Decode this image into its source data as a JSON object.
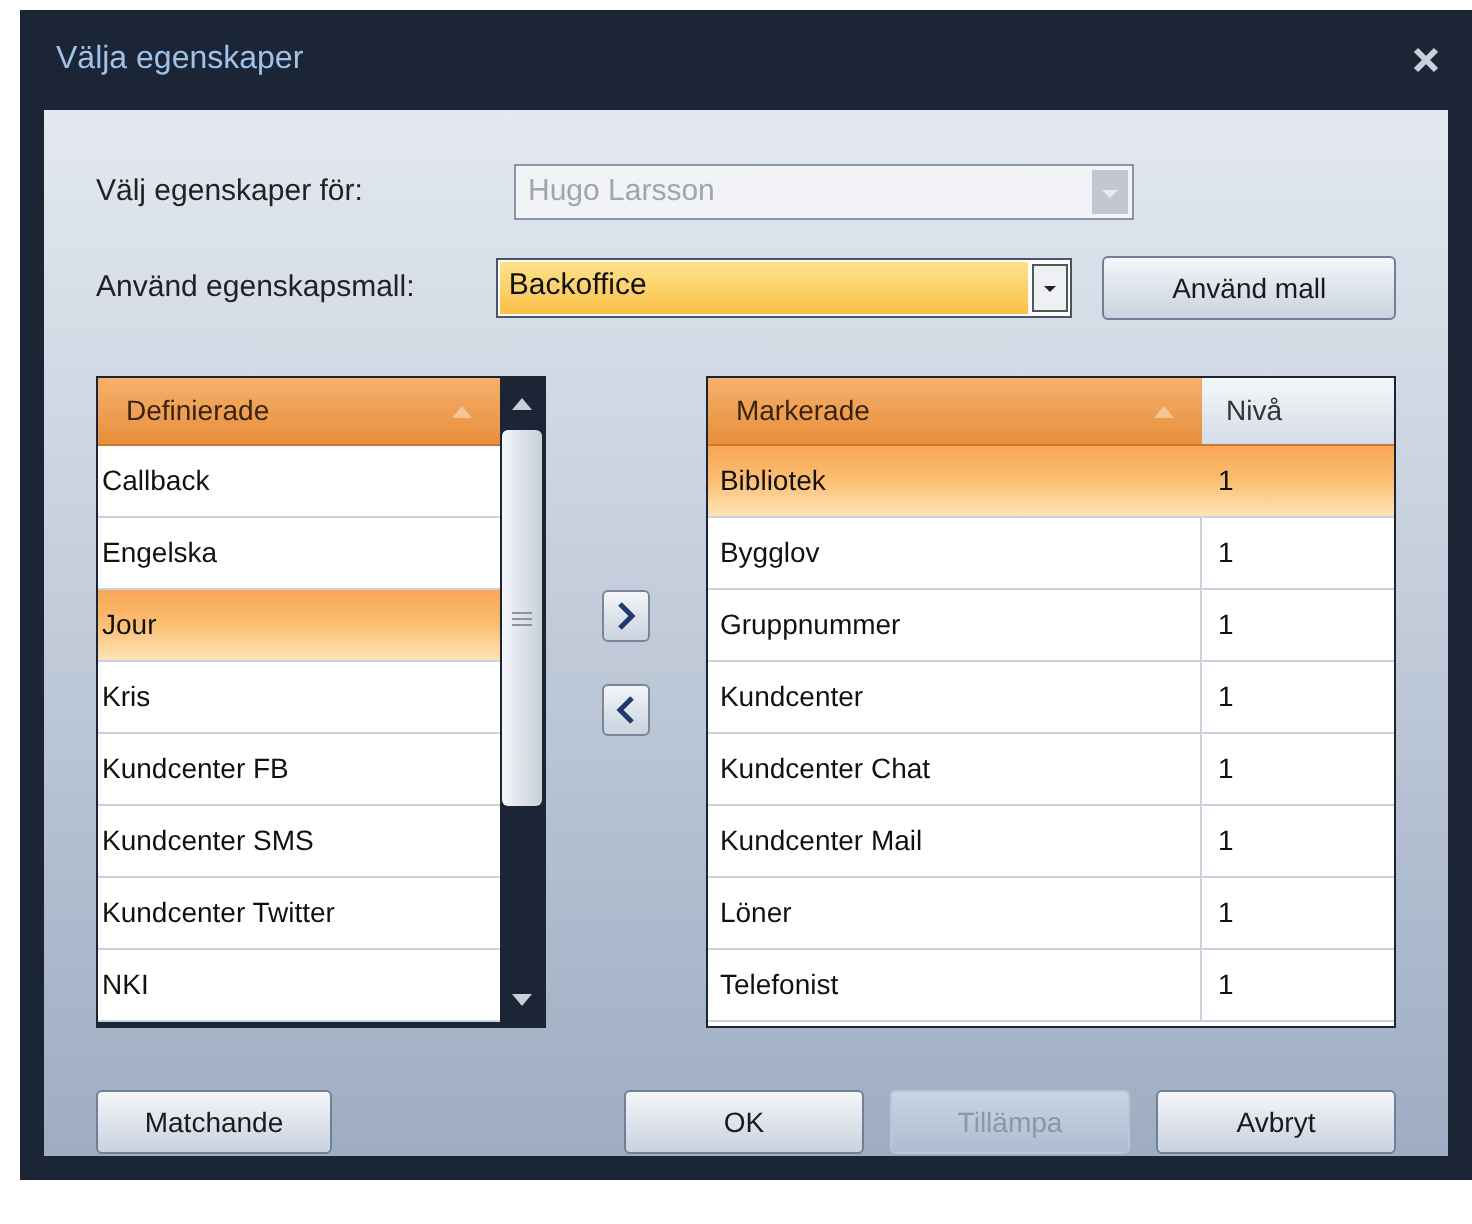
{
  "window": {
    "title": "Välja egenskaper"
  },
  "owner": {
    "label": "Välj egenskaper för:",
    "value": "Hugo Larsson",
    "disabled": true
  },
  "template": {
    "label": "Använd egenskapsmall:",
    "value": "Backoffice",
    "button": "Använd mall"
  },
  "defined": {
    "header": "Definierade",
    "items": [
      {
        "label": "Callback",
        "selected": false
      },
      {
        "label": "Engelska",
        "selected": false
      },
      {
        "label": "Jour",
        "selected": true
      },
      {
        "label": "Kris",
        "selected": false
      },
      {
        "label": "Kundcenter FB",
        "selected": false
      },
      {
        "label": "Kundcenter SMS",
        "selected": false
      },
      {
        "label": "Kundcenter Twitter",
        "selected": false
      },
      {
        "label": "NKI",
        "selected": false
      }
    ]
  },
  "marked": {
    "columns": [
      "Markerade",
      "Nivå"
    ],
    "rows": [
      {
        "cells": [
          "Bibliotek",
          "1"
        ],
        "selected": true
      },
      {
        "cells": [
          "Bygglov",
          "1"
        ],
        "selected": false
      },
      {
        "cells": [
          "Gruppnummer",
          "1"
        ],
        "selected": false
      },
      {
        "cells": [
          "Kundcenter",
          "1"
        ],
        "selected": false
      },
      {
        "cells": [
          "Kundcenter Chat",
          "1"
        ],
        "selected": false
      },
      {
        "cells": [
          "Kundcenter Mail",
          "1"
        ],
        "selected": false
      },
      {
        "cells": [
          "Löner",
          "1"
        ],
        "selected": false
      },
      {
        "cells": [
          "Telefonist",
          "1"
        ],
        "selected": false
      }
    ]
  },
  "buttons": [
    {
      "label": "Matchande",
      "disabled": false
    },
    {
      "label": "OK",
      "disabled": false
    },
    {
      "label": "Tillämpa",
      "disabled": true
    },
    {
      "label": "Avbryt",
      "disabled": false
    }
  ]
}
